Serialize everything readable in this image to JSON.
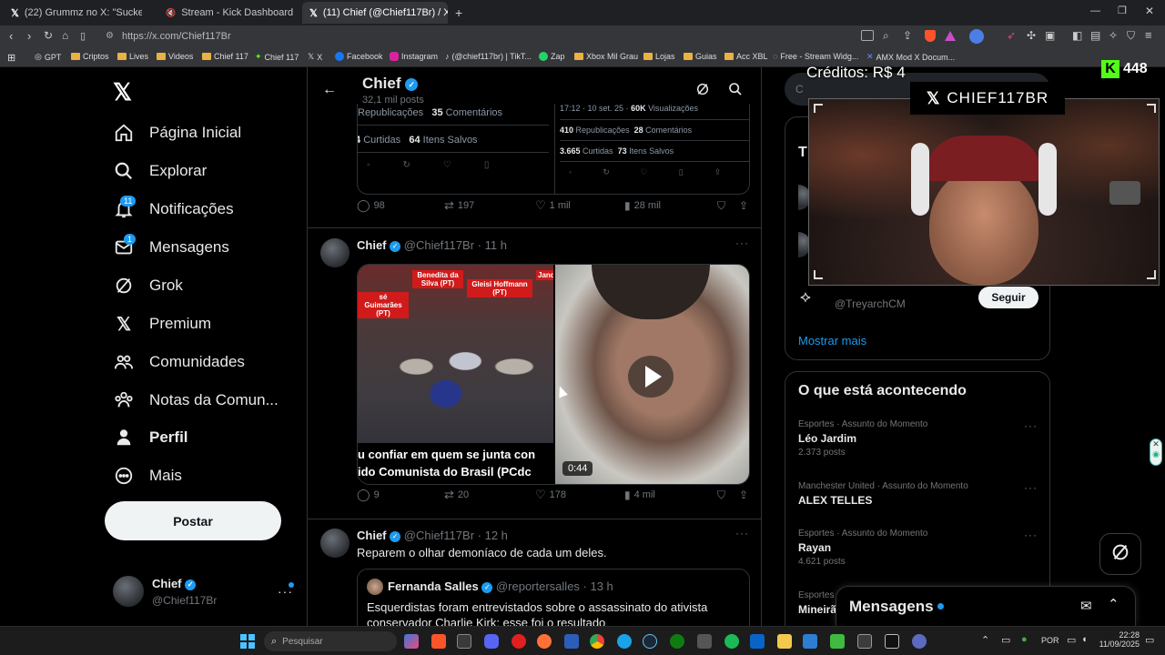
{
  "browser": {
    "tabs": [
      {
        "title": "(22) Grummz no X: \"Suckerpunch Ser",
        "active": false
      },
      {
        "title": "Stream - Kick Dashboard",
        "active": false
      },
      {
        "title": "(11) Chief (@Chief117Br) / X",
        "active": true
      }
    ],
    "url": "https://x.com/Chief117Br",
    "bookmarks": [
      "GPT",
      "Criptos",
      "Lives",
      "Videos",
      "Chief 117",
      "Chief 117",
      "X",
      "Facebook",
      "Instagram",
      "(@chief117br) | TikT...",
      "Zap",
      "Xbox Mil Grau",
      "Lojas",
      "Guias",
      "Acc XBL",
      "Free - Stream Widg...",
      "AMX Mod X Docum..."
    ]
  },
  "sidebar": {
    "items": [
      {
        "label": "Página Inicial",
        "icon": "home-icon"
      },
      {
        "label": "Explorar",
        "icon": "search-icon"
      },
      {
        "label": "Notificações",
        "icon": "bell-icon",
        "badge": "11"
      },
      {
        "label": "Mensagens",
        "icon": "mail-icon",
        "badge": "1"
      },
      {
        "label": "Grok",
        "icon": "grok-icon"
      },
      {
        "label": "Premium",
        "icon": "x-logo-icon"
      },
      {
        "label": "Comunidades",
        "icon": "people-icon"
      },
      {
        "label": "Notas da Comun...",
        "icon": "community-notes-icon"
      },
      {
        "label": "Perfil",
        "icon": "person-icon"
      },
      {
        "label": "Mais",
        "icon": "more-icon"
      }
    ],
    "post_button": "Postar",
    "account_name": "Chief",
    "account_handle": "@Chief117Br"
  },
  "header": {
    "name": "Chief",
    "posts_count": "32,1 mil posts"
  },
  "quoted_stats": {
    "left_reposts_label": "Republicações",
    "left_comments": "35",
    "left_comments_label": "Comentários",
    "left_likes": "4",
    "left_likes_label": "Curtidas",
    "left_saves": "64",
    "left_saves_label": "Itens Salvos",
    "right_time": "17:12 · 10 set. 25 ·",
    "right_views": "60K",
    "right_views_label": "Visualizações",
    "right_reposts": "410",
    "right_reposts_label": "Republicações",
    "right_comments": "28",
    "right_comments_label": "Comentários",
    "right_likes": "3.665",
    "right_likes_label": "Curtidas",
    "right_saves": "73",
    "right_saves_label": "Itens Salvos"
  },
  "post1_actions": {
    "replies": "98",
    "reposts": "197",
    "likes": "1 mil",
    "views": "28 mil"
  },
  "post2": {
    "name": "Chief",
    "handle": "@Chief117Br",
    "time": "· 11 h",
    "image_labels": [
      "Benedita da Silva (PT)",
      "Gleisi Hoffmann (PT)",
      "sé Guimarães (PT)",
      "Jand"
    ],
    "caption_line1": "u confiar em quem se junta con",
    "caption_line2": "ido Comunista do Brasil (PCdc",
    "duration": "0:44",
    "replies": "9",
    "reposts": "20",
    "likes": "178",
    "views": "4 mil"
  },
  "post3": {
    "name": "Chief",
    "handle": "@Chief117Br",
    "time": "· 12 h",
    "text": "Reparem o olhar demoníaco de cada um deles.",
    "quote_name": "Fernanda Salles",
    "quote_handle": "@reportersalles",
    "quote_time": "· 13 h",
    "quote_text_line1": "Esquerdistas foram entrevistados sobre o assassinato do ativista",
    "quote_text_line2": "conservador Charlie Kirk; esse foi o resultado"
  },
  "right": {
    "follow_handle": "@TreyarchCM",
    "follow_button": "Seguir",
    "show_more": "Mostrar mais",
    "trending_title": "O que está acontecendo",
    "trends": [
      {
        "meta": "Esportes · Assunto do Momento",
        "title": "Léo Jardim",
        "count": "2.373 posts"
      },
      {
        "meta": "Manchester United · Assunto do Momento",
        "title": "ALEX TELLES",
        "count": ""
      },
      {
        "meta": "Esportes · Assunto do Momento",
        "title": "Rayan",
        "count": "4.621 posts"
      },
      {
        "meta": "Esportes · Assunto do Momento",
        "title": "Mineirã",
        "count": ""
      }
    ],
    "messages_label": "Mensagens"
  },
  "overlay": {
    "credits": "Créditos: R$ 4",
    "viewers": "448",
    "channel": "CHIEF117BR"
  },
  "taskbar": {
    "search_placeholder": "Pesquisar",
    "lang": "POR",
    "time": "22:28",
    "date": "11/09/2025"
  },
  "colors": {
    "accent": "#1d9bf0",
    "kick_green": "#53fc18",
    "background": "#000000",
    "border": "#2f3336"
  }
}
